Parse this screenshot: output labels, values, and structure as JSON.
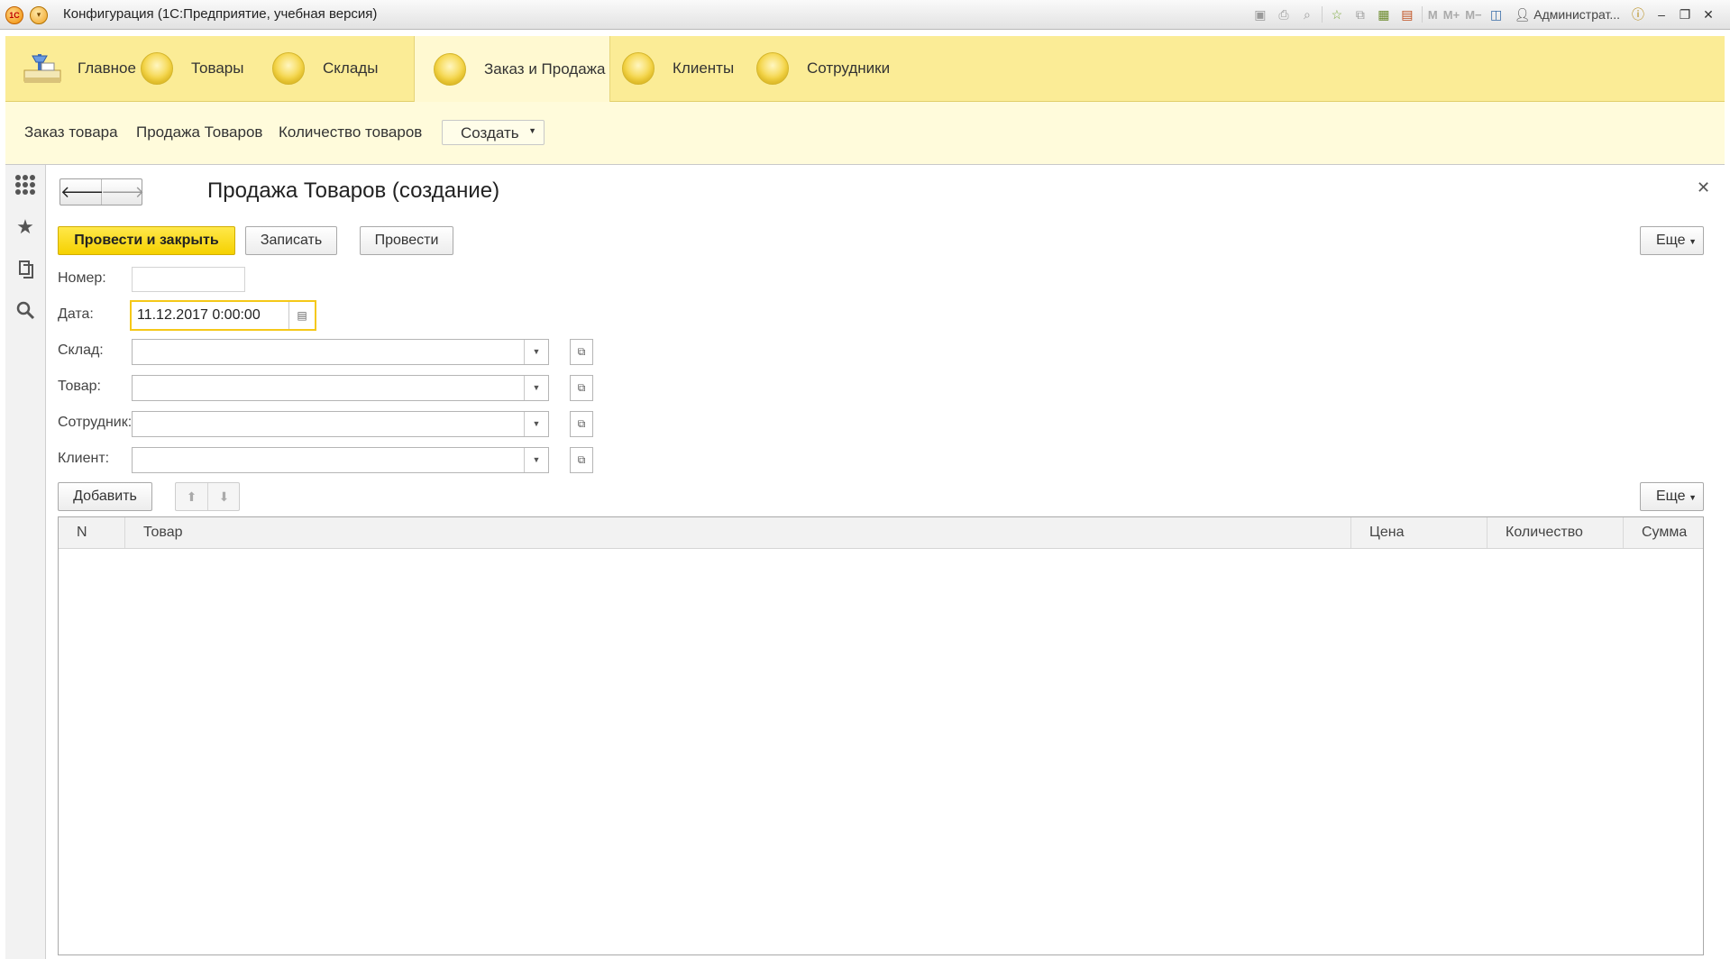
{
  "window": {
    "title": "Конфигурация (1С:Предприятие, учебная версия)",
    "user": "Администрат..."
  },
  "sections": [
    {
      "label": "Главное"
    },
    {
      "label": "Товары"
    },
    {
      "label": "Склады"
    },
    {
      "label": "Заказ и Продажа",
      "active": true
    },
    {
      "label": "Клиенты"
    },
    {
      "label": "Сотрудники"
    }
  ],
  "functions": {
    "items": [
      "Заказ товара",
      "Продажа Товаров",
      "Количество товаров"
    ],
    "create_label": "Создать"
  },
  "form": {
    "title": "Продажа Товаров (создание)",
    "buttons": {
      "post_close": "Провести и закрыть",
      "save": "Записать",
      "post": "Провести",
      "more": "Еще"
    },
    "fields": {
      "number_label": "Номер:",
      "number_value": "",
      "date_label": "Дата:",
      "date_value": "11.12.2017  0:00:00",
      "warehouse_label": "Склад:",
      "product_label": "Товар:",
      "employee_label": "Сотрудник:",
      "client_label": "Клиент:"
    },
    "table": {
      "add_label": "Добавить",
      "more_label": "Еще",
      "columns": [
        "N",
        "Товар",
        "Цена",
        "Количество",
        "Сумма"
      ],
      "rows": []
    }
  },
  "colors": {
    "accent_yellow": "#f5d100",
    "section_bg": "#fbec96",
    "function_bg": "#fffbdb"
  }
}
